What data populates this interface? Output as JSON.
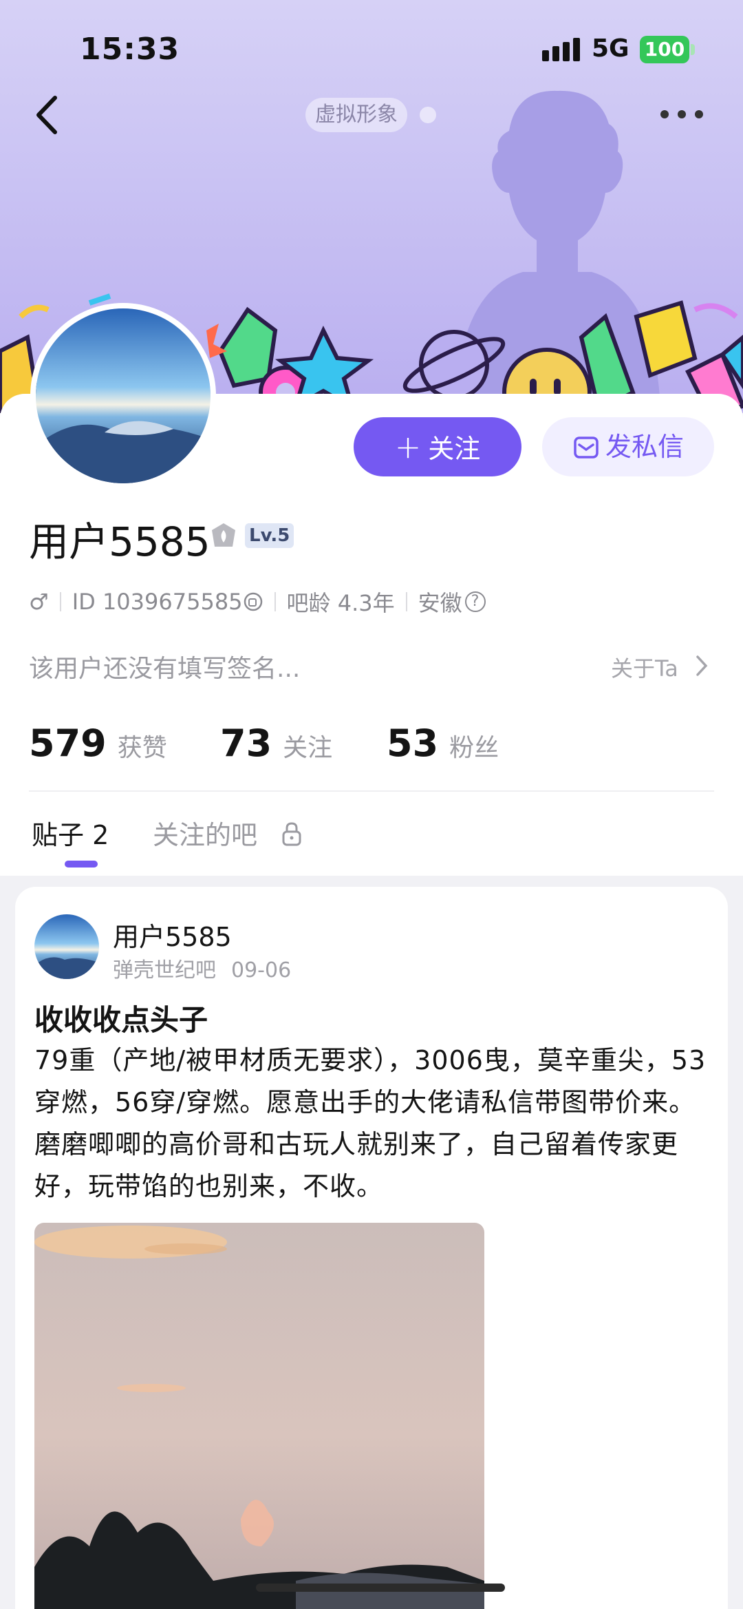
{
  "status_bar": {
    "time": "15:33",
    "network": "5G",
    "battery": "100"
  },
  "header": {
    "avatar_tag": "虚拟形象"
  },
  "profile": {
    "name": "用户5585",
    "level": "Lv.5",
    "gender_symbol": "♂",
    "id_text": "ID 1039675585",
    "age_text": "吧龄 4.3年",
    "location": "安徽",
    "signature": "该用户还没有填写签名...",
    "about_label": "关于Ta",
    "follow_label": "关注",
    "message_label": "发私信"
  },
  "stats": [
    {
      "value": "579",
      "label": "获赞"
    },
    {
      "value": "73",
      "label": "关注"
    },
    {
      "value": "53",
      "label": "粉丝"
    }
  ],
  "tabs": {
    "posts": "贴子 2",
    "bars": "关注的吧"
  },
  "post": {
    "author": "用户5585",
    "forum": "弹壳世纪吧",
    "date": "09-06",
    "title": "收收收点头子",
    "body": "79重（产地/被甲材质无要求），3006曳，莫辛重尖，53穿燃，56穿/穿燃。愿意出手的大佬请私信带图带价来。磨磨唧唧的高价哥和古玩人就别来了，自己留着传家更好，玩带馅的也别来，不收。"
  },
  "colors": {
    "accent": "#7559f2",
    "banner": "#c9c2f3",
    "battery": "#34c759"
  }
}
